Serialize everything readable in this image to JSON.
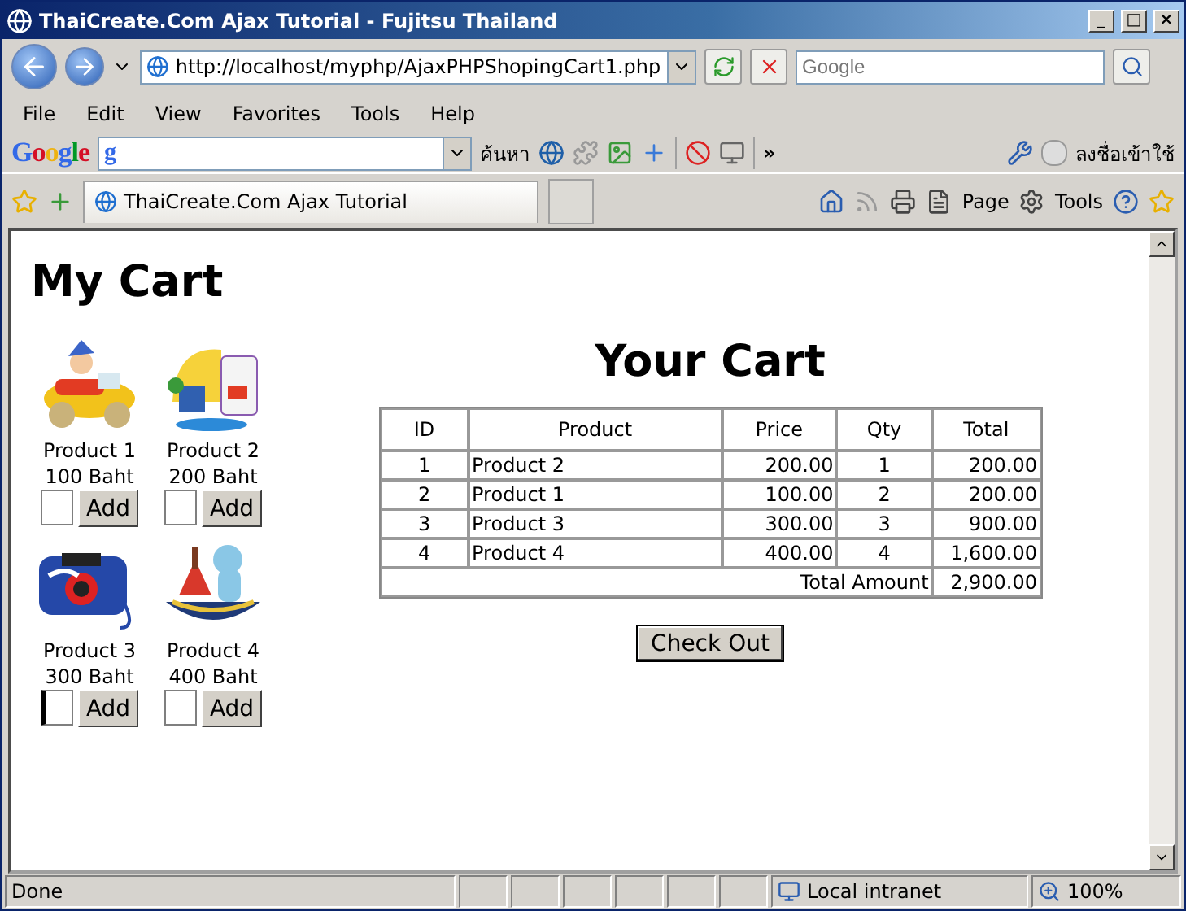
{
  "window": {
    "title": "ThaiCreate.Com Ajax Tutorial - Fujitsu Thailand",
    "controls": [
      "_",
      "□",
      "×"
    ]
  },
  "address_bar": {
    "url": "http://localhost/myphp/AjaxPHPShopingCart1.php",
    "search_placeholder": "Google"
  },
  "menu": [
    "File",
    "Edit",
    "View",
    "Favorites",
    "Tools",
    "Help"
  ],
  "google_toolbar": {
    "logo": "Google",
    "engine_glyph": "g",
    "search_label": "ค้นหา",
    "more": "»",
    "signin": "ลงชื่อเข้าใช้"
  },
  "tab": {
    "title": "ThaiCreate.Com Ajax Tutorial"
  },
  "command_bar": [
    "Page",
    "Tools"
  ],
  "page": {
    "heading": "My Cart",
    "products": [
      {
        "name": "Product 1",
        "price": "100 Baht",
        "add_label": "Add",
        "focused": false
      },
      {
        "name": "Product 2",
        "price": "200 Baht",
        "add_label": "Add",
        "focused": false
      },
      {
        "name": "Product 3",
        "price": "300 Baht",
        "add_label": "Add",
        "focused": true
      },
      {
        "name": "Product 4",
        "price": "400 Baht",
        "add_label": "Add",
        "focused": false
      }
    ],
    "cart_heading": "Your Cart",
    "columns": [
      "ID",
      "Product",
      "Price",
      "Qty",
      "Total"
    ],
    "rows": [
      [
        "1",
        "Product 2",
        "200.00",
        "1",
        "200.00"
      ],
      [
        "2",
        "Product 1",
        "100.00",
        "2",
        "200.00"
      ],
      [
        "3",
        "Product 3",
        "300.00",
        "3",
        "900.00"
      ],
      [
        "4",
        "Product 4",
        "400.00",
        "4",
        "1,600.00"
      ]
    ],
    "total_label": "Total Amount",
    "total_value": "2,900.00",
    "checkout": "Check Out"
  },
  "status_bar": {
    "text": "Done",
    "zone": "Local intranet",
    "zoom": "100%"
  }
}
